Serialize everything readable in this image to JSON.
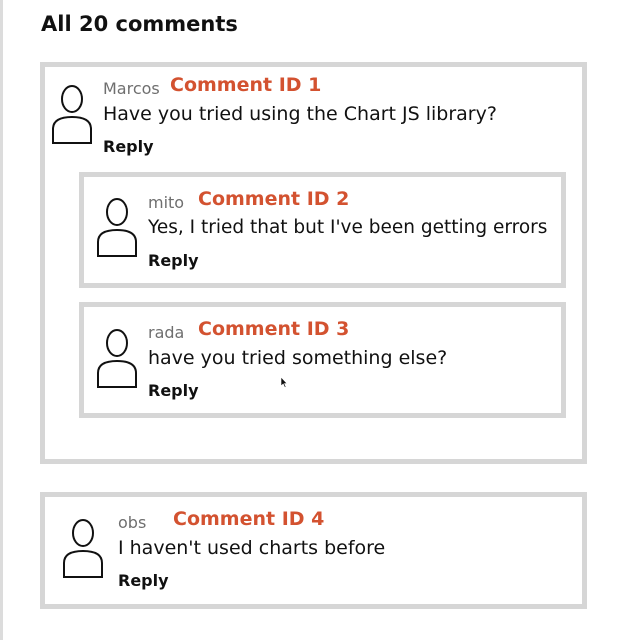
{
  "header": {
    "title": "All 20 comments"
  },
  "comments": [
    {
      "author": "Marcos",
      "id_label": "Comment ID 1",
      "text": "Have you tried using the Chart JS library?",
      "reply_label": "Reply"
    },
    {
      "author": "mito",
      "id_label": "Comment ID 2",
      "text": "Yes, I tried that but I've been getting errors",
      "reply_label": "Reply"
    },
    {
      "author": "rada",
      "id_label": "Comment ID 3",
      "text": "have you tried something else?",
      "reply_label": "Reply"
    },
    {
      "author": "obs",
      "id_label": "Comment ID 4",
      "text": "I haven't used charts before",
      "reply_label": "Reply"
    }
  ],
  "icons": {
    "avatar": "user-outline-icon",
    "cursor": "mouse-pointer-icon"
  },
  "colors": {
    "comment_id": "#d35230",
    "border": "#d6d6d6",
    "author": "#6f6f6f"
  }
}
